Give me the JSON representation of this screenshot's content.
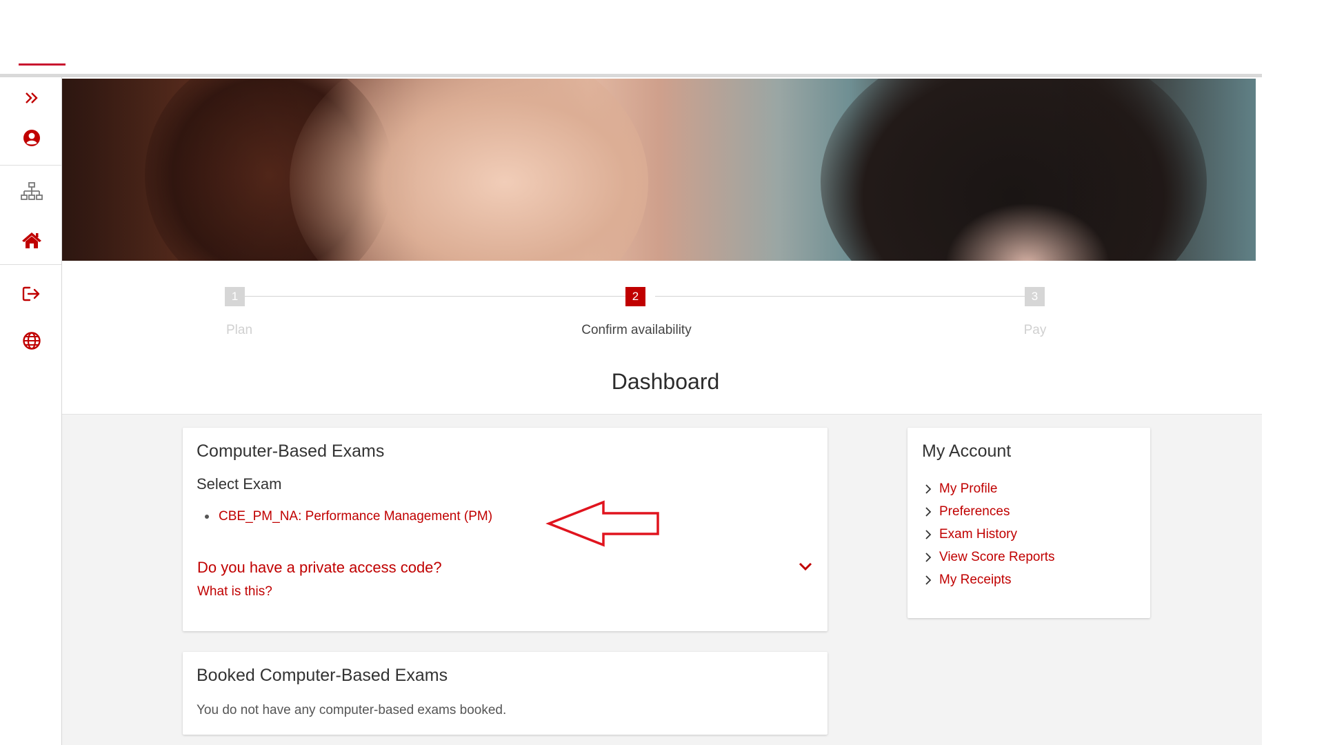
{
  "colors": {
    "accent": "#c00000",
    "brand_red": "#c8102e",
    "content_bg": "#f3f3f3",
    "step_inactive": "#d6d6d6"
  },
  "sidebar": {
    "items": [
      {
        "icon": "double-chevron-right-icon"
      },
      {
        "icon": "user-circle-icon"
      },
      {
        "icon": "sitemap-icon"
      },
      {
        "icon": "home-icon"
      },
      {
        "icon": "sign-out-icon"
      },
      {
        "icon": "globe-icon"
      }
    ]
  },
  "stepper": {
    "steps": [
      {
        "number": "1",
        "label": "Plan",
        "state": "inactive"
      },
      {
        "number": "2",
        "label": "Confirm availability",
        "state": "active"
      },
      {
        "number": "3",
        "label": "Pay",
        "state": "inactive"
      }
    ]
  },
  "page": {
    "title": "Dashboard"
  },
  "cbe": {
    "title": "Computer-Based Exams",
    "select_label": "Select Exam",
    "exams": [
      "CBE_PM_NA: Performance Management (PM)"
    ],
    "access_question": "Do you have a private access code?",
    "access_help": "What is this?"
  },
  "booked": {
    "title": "Booked Computer-Based Exams",
    "empty_text": "You do not have any computer-based exams booked."
  },
  "account": {
    "title": "My Account",
    "links": [
      "My Profile",
      "Preferences",
      "Exam History",
      "View Score Reports",
      "My Receipts"
    ]
  }
}
